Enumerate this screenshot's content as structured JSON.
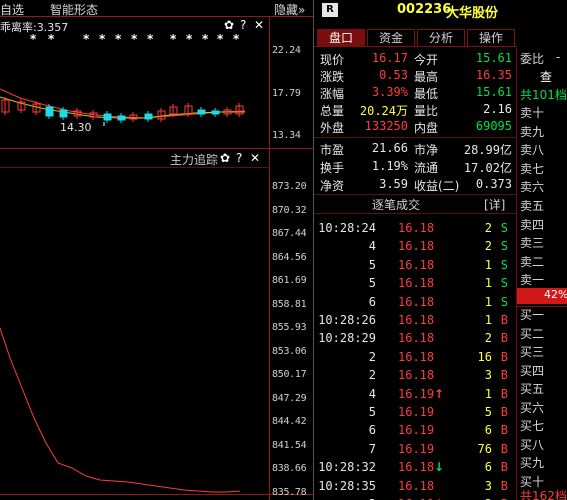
{
  "top_bar": {
    "menu_left": "自选",
    "menu_shape": "智能形态",
    "hide_label": "隐藏",
    "hide_arrow": "»",
    "r_badge": "R",
    "stock_code": "002236",
    "stock_name": "大华股份"
  },
  "kline_panel": {
    "indicator_label": "乖离率:3.357",
    "stars": [
      "*",
      "*",
      "*",
      "*",
      "*",
      "*",
      "*",
      "*",
      "*",
      "*",
      "*",
      "*",
      "*",
      "*"
    ],
    "min_price_label": "14.30",
    "y_labels": [
      "22.24",
      "17.79",
      "13.34"
    ],
    "candle_colors": {
      "up": "#ff3b3b",
      "down": "#20d8e8",
      "ma": "#ff3b3b",
      "ma2": "#c8c828"
    }
  },
  "main_force_panel": {
    "title": "主力追踪",
    "y_labels": [
      "873.20",
      "870.32",
      "867.44",
      "864.56",
      "861.69",
      "858.81",
      "855.93",
      "853.06",
      "850.17",
      "847.29",
      "844.42",
      "841.54",
      "838.66",
      "835.78"
    ],
    "line_color": "#ff3b3b"
  },
  "panel_icons": {
    "gear": "✿",
    "help": "?",
    "close": "✕"
  },
  "tabs": [
    {
      "label": "盘口",
      "active": true
    },
    {
      "label": "资金",
      "active": false
    },
    {
      "label": "分析",
      "active": false
    },
    {
      "label": "操作",
      "active": false
    }
  ],
  "quote": [
    {
      "l1": "现价",
      "v1": "16.17",
      "c1": "red",
      "l2": "今开",
      "v2": "15.61",
      "c2": "green"
    },
    {
      "l1": "涨跌",
      "v1": "0.53",
      "c1": "red",
      "l2": "最高",
      "v2": "16.35",
      "c2": "red"
    },
    {
      "l1": "涨幅",
      "v1": "3.39%",
      "c1": "red",
      "l2": "最低",
      "v2": "15.61",
      "c2": "green"
    },
    {
      "l1": "总量",
      "v1": "20.24万",
      "c1": "yellow",
      "l2": "量比",
      "v2": "2.16",
      "c2": "white"
    },
    {
      "l1": "外盘",
      "v1": "133250",
      "c1": "red",
      "l2": "内盘",
      "v2": "69095",
      "c2": "green"
    }
  ],
  "quote2": [
    {
      "l1": "市盈",
      "v1": "21.66",
      "l2": "市净",
      "v2": "28.99亿"
    },
    {
      "l1": "换手",
      "v1": "1.19%",
      "l2": "流通",
      "v2": "17.02亿"
    },
    {
      "l1": "净资",
      "v1": "3.59",
      "l2": "收益(二)",
      "v2": "0.373"
    }
  ],
  "trades_header": {
    "title": "逐笔成交",
    "detail": "[详]"
  },
  "trades": [
    {
      "time": "10:28:24",
      "price": "16.18",
      "vol": "2",
      "side": "S",
      "arrow": ""
    },
    {
      "time": "4",
      "price": "16.18",
      "vol": "2",
      "side": "S",
      "arrow": ""
    },
    {
      "time": "5",
      "price": "16.18",
      "vol": "1",
      "side": "S",
      "arrow": ""
    },
    {
      "time": "5",
      "price": "16.18",
      "vol": "1",
      "side": "S",
      "arrow": ""
    },
    {
      "time": "6",
      "price": "16.18",
      "vol": "1",
      "side": "S",
      "arrow": ""
    },
    {
      "time": "10:28:26",
      "price": "16.18",
      "vol": "1",
      "side": "B",
      "arrow": ""
    },
    {
      "time": "10:28:29",
      "price": "16.18",
      "vol": "2",
      "side": "B",
      "arrow": ""
    },
    {
      "time": "2",
      "price": "16.18",
      "vol": "16",
      "side": "B",
      "arrow": ""
    },
    {
      "time": "2",
      "price": "16.18",
      "vol": "3",
      "side": "B",
      "arrow": ""
    },
    {
      "time": "4",
      "price": "16.19",
      "vol": "1",
      "side": "B",
      "arrow": "↑"
    },
    {
      "time": "5",
      "price": "16.19",
      "vol": "5",
      "side": "B",
      "arrow": ""
    },
    {
      "time": "6",
      "price": "16.19",
      "vol": "6",
      "side": "B",
      "arrow": ""
    },
    {
      "time": "7",
      "price": "16.19",
      "vol": "76",
      "side": "B",
      "arrow": ""
    },
    {
      "time": "10:28:32",
      "price": "16.18",
      "vol": "6",
      "side": "B",
      "arrow": "↓"
    },
    {
      "time": "10:28:35",
      "price": "16.18",
      "vol": "3",
      "side": "B",
      "arrow": ""
    },
    {
      "time": "2",
      "price": "16.19",
      "vol": "2",
      "side": "B",
      "arrow": "↑"
    }
  ],
  "order_book": {
    "header": "委比",
    "header_value": "-",
    "sell_count": "共101档",
    "sell_suffix": "查",
    "sell": [
      "卖十",
      "卖九",
      "卖八",
      "卖七",
      "卖六",
      "卖五",
      "卖四",
      "卖三",
      "卖二",
      "卖一"
    ],
    "ratio": "42%",
    "buy": [
      "买一",
      "买二",
      "买三",
      "买四",
      "买五",
      "买六",
      "买七",
      "买八",
      "买九",
      "买十"
    ],
    "buy_count": "共162档"
  }
}
